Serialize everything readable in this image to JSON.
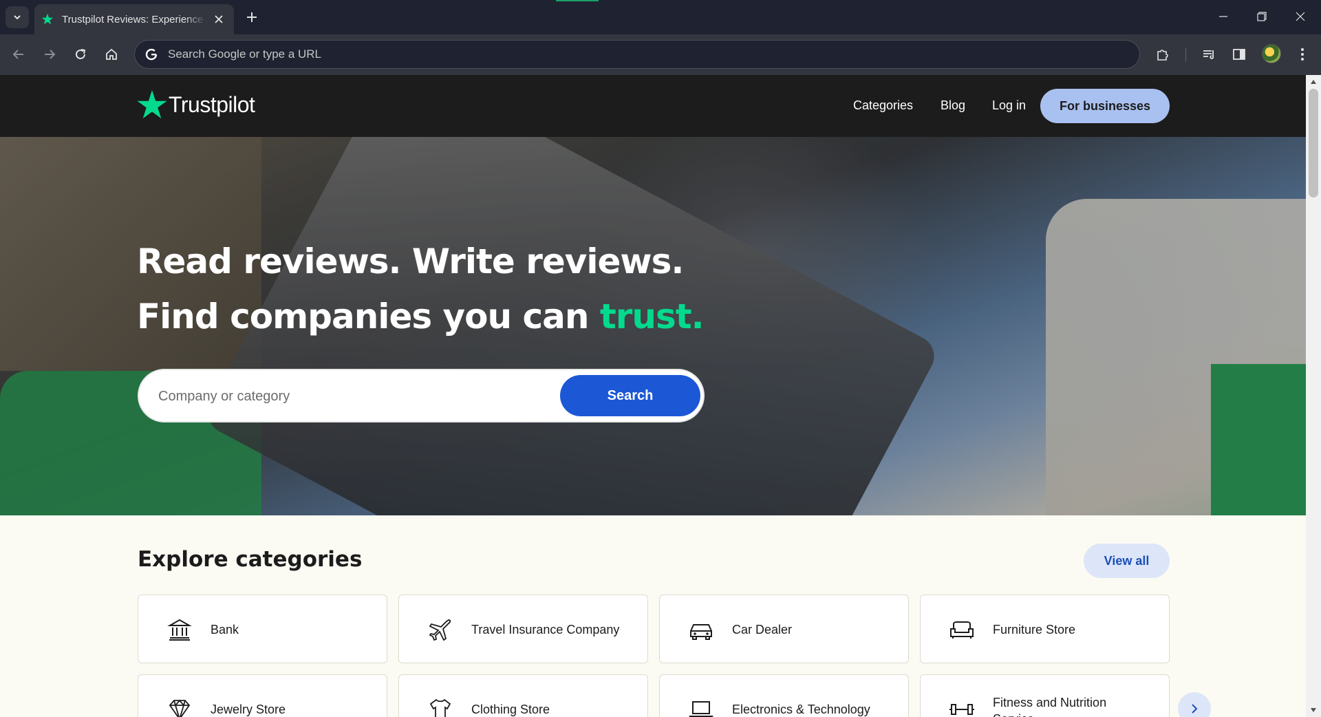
{
  "browser": {
    "tab_title": "Trustpilot Reviews: Experience the power of customer reviews",
    "omnibox_placeholder": "Search Google or type a URL"
  },
  "site": {
    "logo_text": "Trustpilot",
    "nav": {
      "categories": "Categories",
      "blog": "Blog",
      "login": "Log in",
      "for_businesses": "For businesses"
    },
    "hero": {
      "line1": "Read reviews. Write reviews.",
      "line2_prefix": "Find companies you can ",
      "line2_accent": "trust.",
      "search_placeholder": "Company or category",
      "search_button": "Search"
    },
    "categories": {
      "title": "Explore categories",
      "view_all": "View all",
      "items": [
        {
          "label": "Bank",
          "icon": "bank-icon"
        },
        {
          "label": "Travel Insurance Company",
          "icon": "airplane-icon"
        },
        {
          "label": "Car Dealer",
          "icon": "car-icon"
        },
        {
          "label": "Furniture Store",
          "icon": "sofa-icon"
        },
        {
          "label": "Jewelry Store",
          "icon": "diamond-icon"
        },
        {
          "label": "Clothing Store",
          "icon": "shirt-icon"
        },
        {
          "label": "Electronics & Technology",
          "icon": "laptop-icon"
        },
        {
          "label": "Fitness and Nutrition Service",
          "icon": "dumbbell-icon"
        }
      ]
    }
  },
  "colors": {
    "brand_green": "#04da8d",
    "header_dark": "#1c1c1c",
    "search_blue": "#1c58d6",
    "for_business_bg": "#a9c1f0"
  }
}
